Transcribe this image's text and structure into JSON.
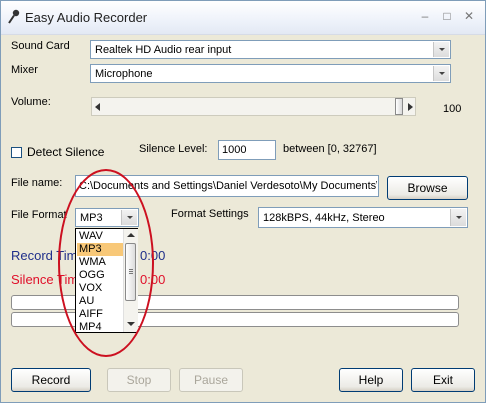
{
  "window": {
    "title": "Easy Audio Recorder",
    "icons": {
      "app": "microphone-icon",
      "minimize": "minimize-icon",
      "maximize": "maximize-icon",
      "close": "close-icon"
    }
  },
  "sound_card": {
    "label": "Sound Card",
    "value": "Realtek HD Audio rear input"
  },
  "mixer": {
    "label": "Mixer",
    "value": "Microphone"
  },
  "volume": {
    "label": "Volume:",
    "value": "100",
    "level": 1.0
  },
  "silence": {
    "detect_label": "Detect Silence",
    "detect_checked": false,
    "level_label": "Silence Level:",
    "level_value": "1000",
    "range_text": "between [0, 32767]"
  },
  "file_name": {
    "label": "File name:",
    "value": "C:\\Documents and Settings\\Daniel Verdesoto\\My Documents\\",
    "browse_label": "Browse"
  },
  "file_format": {
    "label": "File Format",
    "value": "MP3",
    "options": [
      "WAV",
      "MP3",
      "WMA",
      "OGG",
      "VOX",
      "AU",
      "AIFF",
      "MP4"
    ],
    "selected_index": 1
  },
  "format_settings": {
    "label": "Format Settings",
    "value": "128kBPS, 44kHz, Stereo"
  },
  "record_time": {
    "label": "Record Tim",
    "value": "0:00",
    "color": "#1f2f8a"
  },
  "silence_time": {
    "label": "Silence Tim",
    "value": "0:00",
    "color": "#e0102a"
  },
  "buttons": {
    "record": "Record",
    "stop": "Stop",
    "pause": "Pause",
    "help": "Help",
    "exit": "Exit"
  },
  "colors": {
    "highlight": "#f8c878",
    "annotation": "#cc1020"
  }
}
